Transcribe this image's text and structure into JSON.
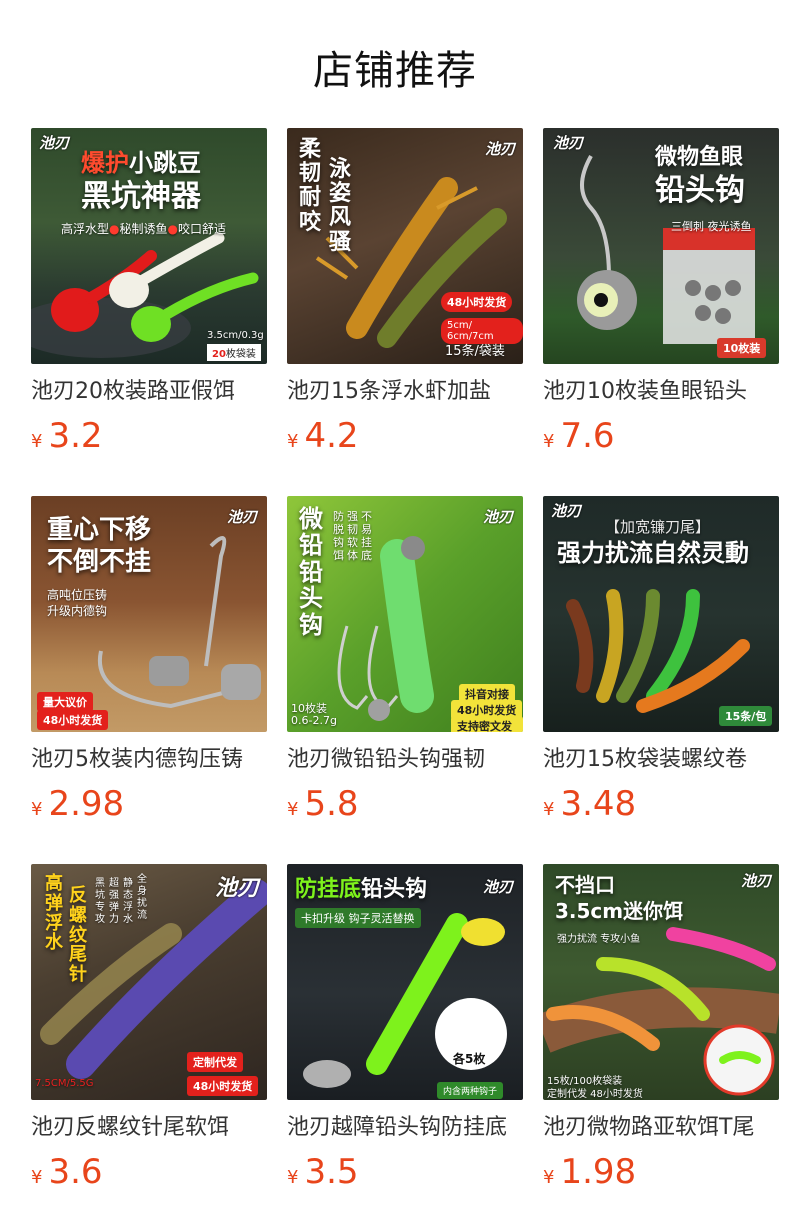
{
  "header": {
    "title": "店铺推荐"
  },
  "currency": "¥",
  "brand_mark": "池刃",
  "products": [
    {
      "name": "池刃20枚装路亚假饵",
      "price": "3.2",
      "image": {
        "headline_red": "爆护",
        "headline_white": "小跳豆",
        "headline2": "黑坑神器",
        "sub1": "高浮水型",
        "sub2": "秘制诱鱼",
        "sub3": "咬口舒适",
        "spec": "3.5cm/0.3g",
        "pack_count": "20",
        "pack_unit": "枚袋装"
      }
    },
    {
      "name": "池刃15条浮水虾加盐",
      "price": "4.2",
      "image": {
        "col1": "柔韧耐咬",
        "col2": "泳姿风骚",
        "ship": "48小时发货",
        "sizes": "5cm/ 6cm/7cm",
        "pack": "15条/袋装"
      }
    },
    {
      "name": "池刃10枚装鱼眼铅头",
      "price": "7.6",
      "image": {
        "line1": "微物鱼眼",
        "line2": "铅头钩",
        "sub": "三倒刺 夜光诱鱼",
        "pack": "10枚装"
      }
    },
    {
      "name": "池刃5枚装内德钩压铸",
      "price": "2.98",
      "image": {
        "line1": "重心下移",
        "line2": "不倒不挂",
        "sub1": "高吨位压铸",
        "sub2": "升级内德钩",
        "tag1": "量大议价",
        "tag2": "48小时发货"
      }
    },
    {
      "name": "池刃微铅铅头钩强韧",
      "price": "5.8",
      "image": {
        "col": "微铅铅头钩",
        "f1": "防脱钩饵",
        "f2": "强韧软体",
        "f3": "不易挂底",
        "count": "10枚装",
        "weight": "0.6-2.7g",
        "tag1": "抖音对接",
        "tag2": "48小时发货",
        "tag3": "支持密文发货"
      }
    },
    {
      "name": "池刃15枚袋装螺纹卷",
      "price": "3.48",
      "image": {
        "line1": "【加宽镰刀尾】",
        "line2": "强力扰流自然灵動",
        "pack": "15条/包"
      }
    },
    {
      "name": "池刃反螺纹针尾软饵",
      "price": "3.6",
      "image": {
        "col1": "高弹浮水",
        "col2": "反螺纹尾针",
        "f1": "黑坑专攻",
        "f2": "超强弹力",
        "f3": "静态浮水",
        "f4": "全身扰流",
        "size": "7.5CM/5.5G",
        "tag1": "定制代发",
        "tag2": "48小时发货"
      }
    },
    {
      "name": "池刃越障铅头钩防挂底",
      "price": "3.5",
      "image": {
        "line1_green": "防挂底",
        "line1_white": "铅头钩",
        "sub": "卡扣升级 钩子灵活替换",
        "each": "各5枚",
        "inner": "内含两种钩子"
      }
    },
    {
      "name": "池刃微物路亚软饵T尾",
      "price": "1.98",
      "image": {
        "line1": "不挡口",
        "line2": "3.5cm迷你饵",
        "sub": "强力扰流  专攻小鱼",
        "pack": "15枚/100枚袋装",
        "note": "定制代发 48小时发货"
      }
    }
  ]
}
